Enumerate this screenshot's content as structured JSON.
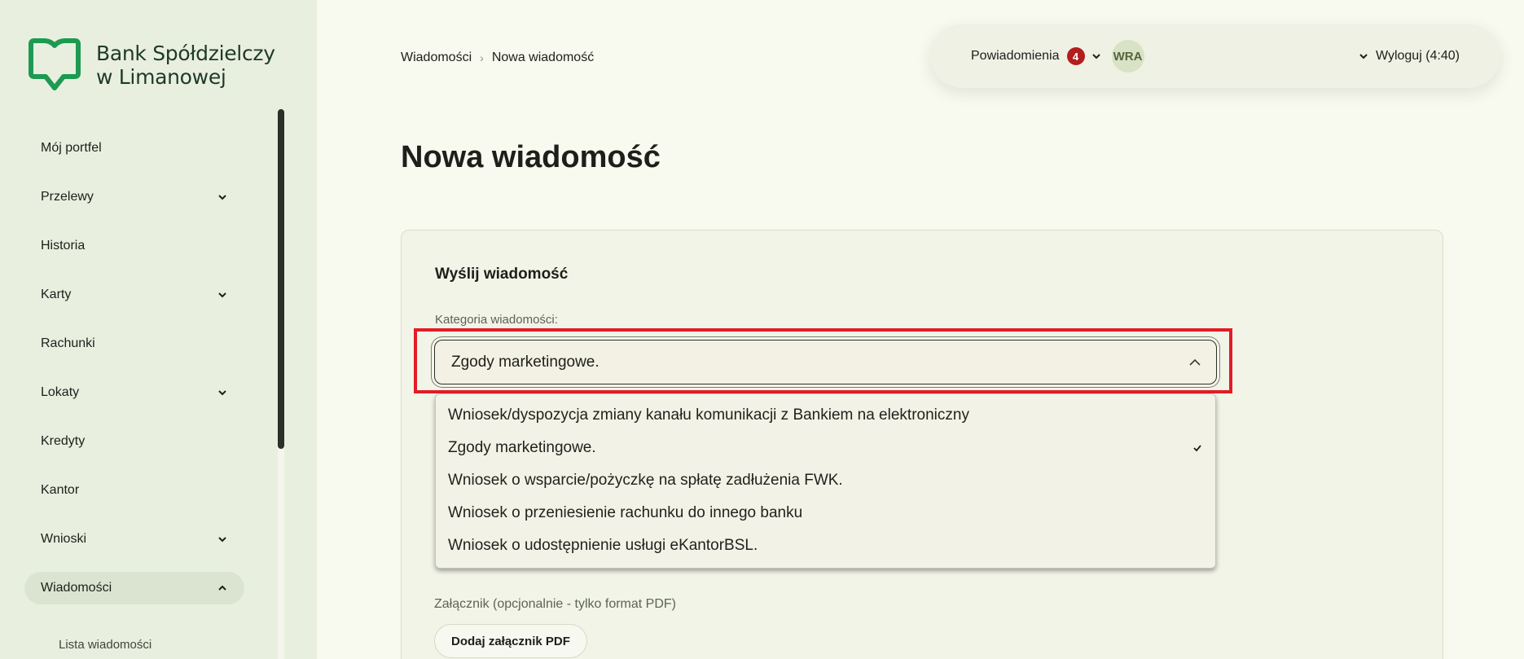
{
  "colors": {
    "brand_green": "#1c9a52",
    "badge_red": "#b31d1d",
    "highlight_red": "#e21c26"
  },
  "logo": {
    "line1": "Bank Spółdzielczy",
    "line2": "w Limanowej",
    "icon": "bank-logo-icon"
  },
  "sidebar": {
    "items": [
      {
        "label": "Mój portfel",
        "expandable": false
      },
      {
        "label": "Przelewy",
        "expandable": true
      },
      {
        "label": "Historia",
        "expandable": false
      },
      {
        "label": "Karty",
        "expandable": true
      },
      {
        "label": "Rachunki",
        "expandable": false
      },
      {
        "label": "Lokaty",
        "expandable": true
      },
      {
        "label": "Kredyty",
        "expandable": false
      },
      {
        "label": "Kantor",
        "expandable": false
      },
      {
        "label": "Wnioski",
        "expandable": true
      },
      {
        "label": "Wiadomości",
        "expandable": true,
        "active": true
      }
    ],
    "sub_item": "Lista wiadomości"
  },
  "breadcrumb": {
    "parent": "Wiadomości",
    "separator": "›",
    "current": "Nowa wiadomość"
  },
  "topbar": {
    "notifications_label": "Powiadomienia",
    "notifications_count": "4",
    "avatar_initials": "WRA",
    "logout_label": "Wyloguj (4:40)"
  },
  "main": {
    "title": "Nowa wiadomość",
    "card_title": "Wyślij wiadomość",
    "category_label": "Kategoria wiadomości:",
    "selected_category": "Zgody marketingowe.",
    "options": [
      "Wniosek/dyspozycja zmiany kanału komunikacji z Bankiem na elektroniczny",
      "Zgody marketingowe.",
      "Wniosek o wsparcie/pożyczkę na spłatę zadłużenia FWK.",
      "Wniosek o przeniesienie rachunku do innego banku",
      "Wniosek o udostępnienie usługi eKantorBSL."
    ],
    "selected_index": 1,
    "attachment_label": "Załącznik (opcjonalnie - tylko format PDF)",
    "attachment_button": "Dodaj załącznik PDF"
  }
}
